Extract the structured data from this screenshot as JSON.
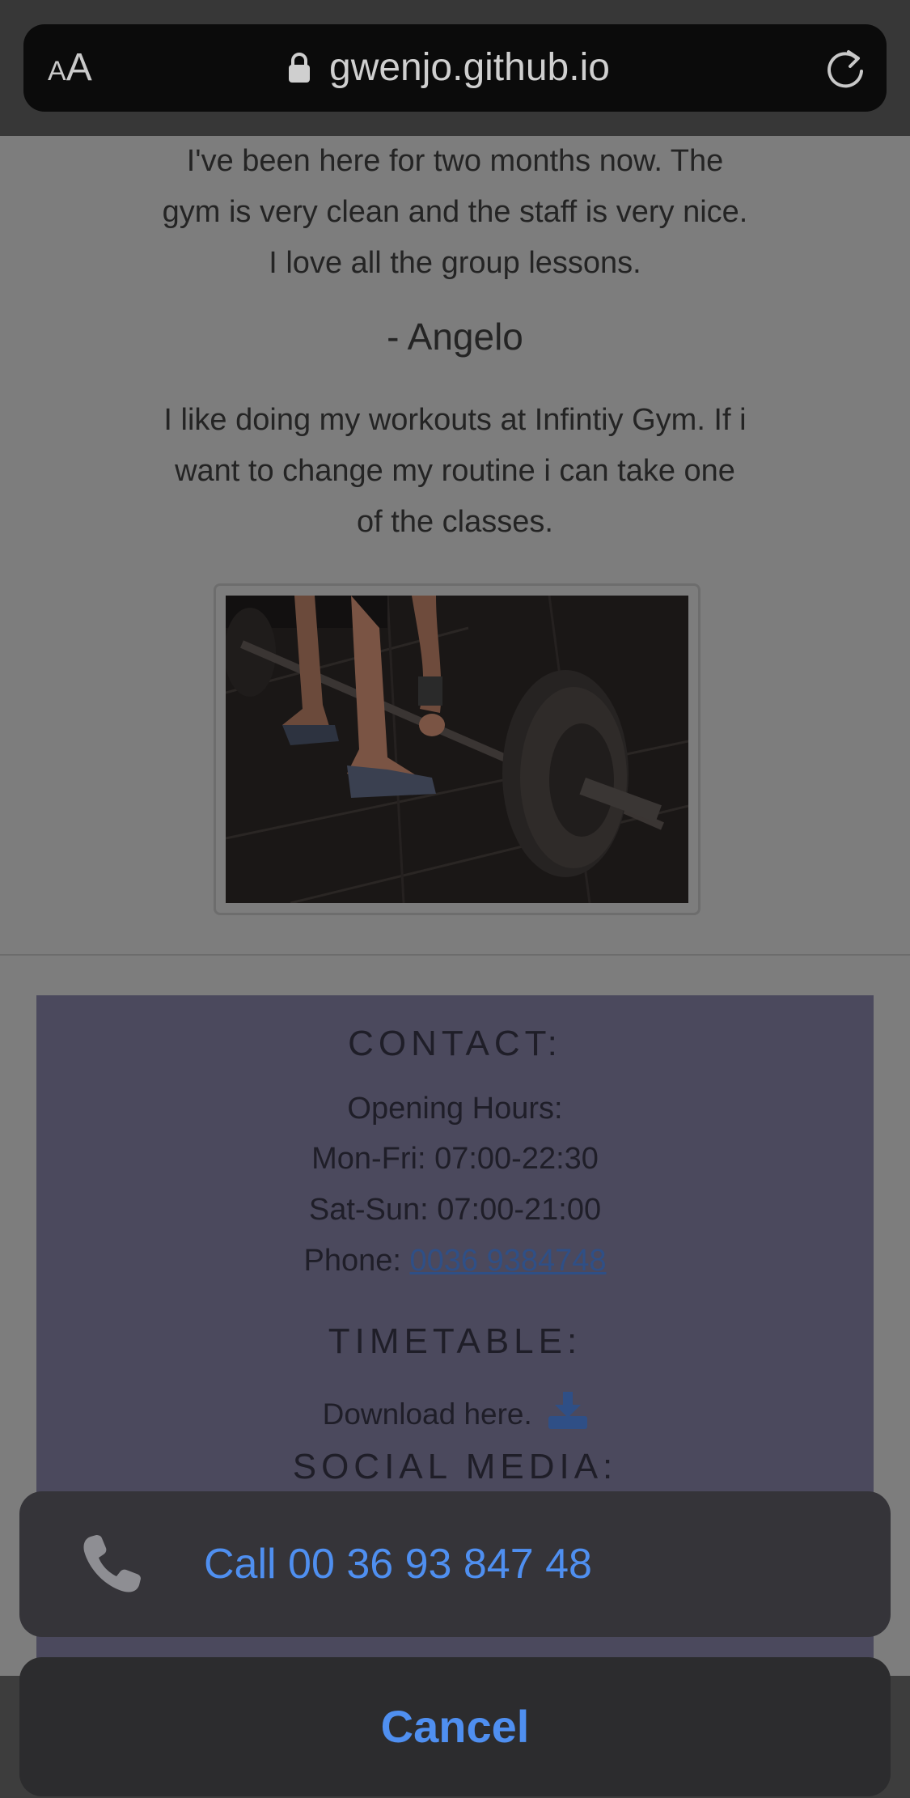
{
  "browser": {
    "text_size_label": "AA",
    "url": "gwenjo.github.io"
  },
  "testimonials": {
    "first_text_lines": [
      "I've been here for two months now. The",
      "gym is very clean and the staff is very nice.",
      "I love all the group lessons."
    ],
    "author": "- Angelo",
    "second_text_lines": [
      "I like doing my workouts at Infintiy Gym. If i",
      "want to change my routine i can take one",
      "of the classes."
    ]
  },
  "contact": {
    "heading": "CONTACT:",
    "opening_hours_label": "Opening Hours:",
    "mon_fri": "Mon-Fri: 07:00-22:30",
    "sat_sun": "Sat-Sun: 07:00-21:00",
    "phone_label": "Phone: ",
    "phone_number": "0036 9384748"
  },
  "timetable": {
    "heading": "TIMETABLE:",
    "download_text": "Download here."
  },
  "social": {
    "heading": "SOCIAL MEDIA:"
  },
  "action_sheet": {
    "call_label": "Call 00 36 93 847 48",
    "cancel_label": "Cancel"
  },
  "colors": {
    "accent": "#4f8ff0",
    "contact_box": "#4b495d"
  }
}
